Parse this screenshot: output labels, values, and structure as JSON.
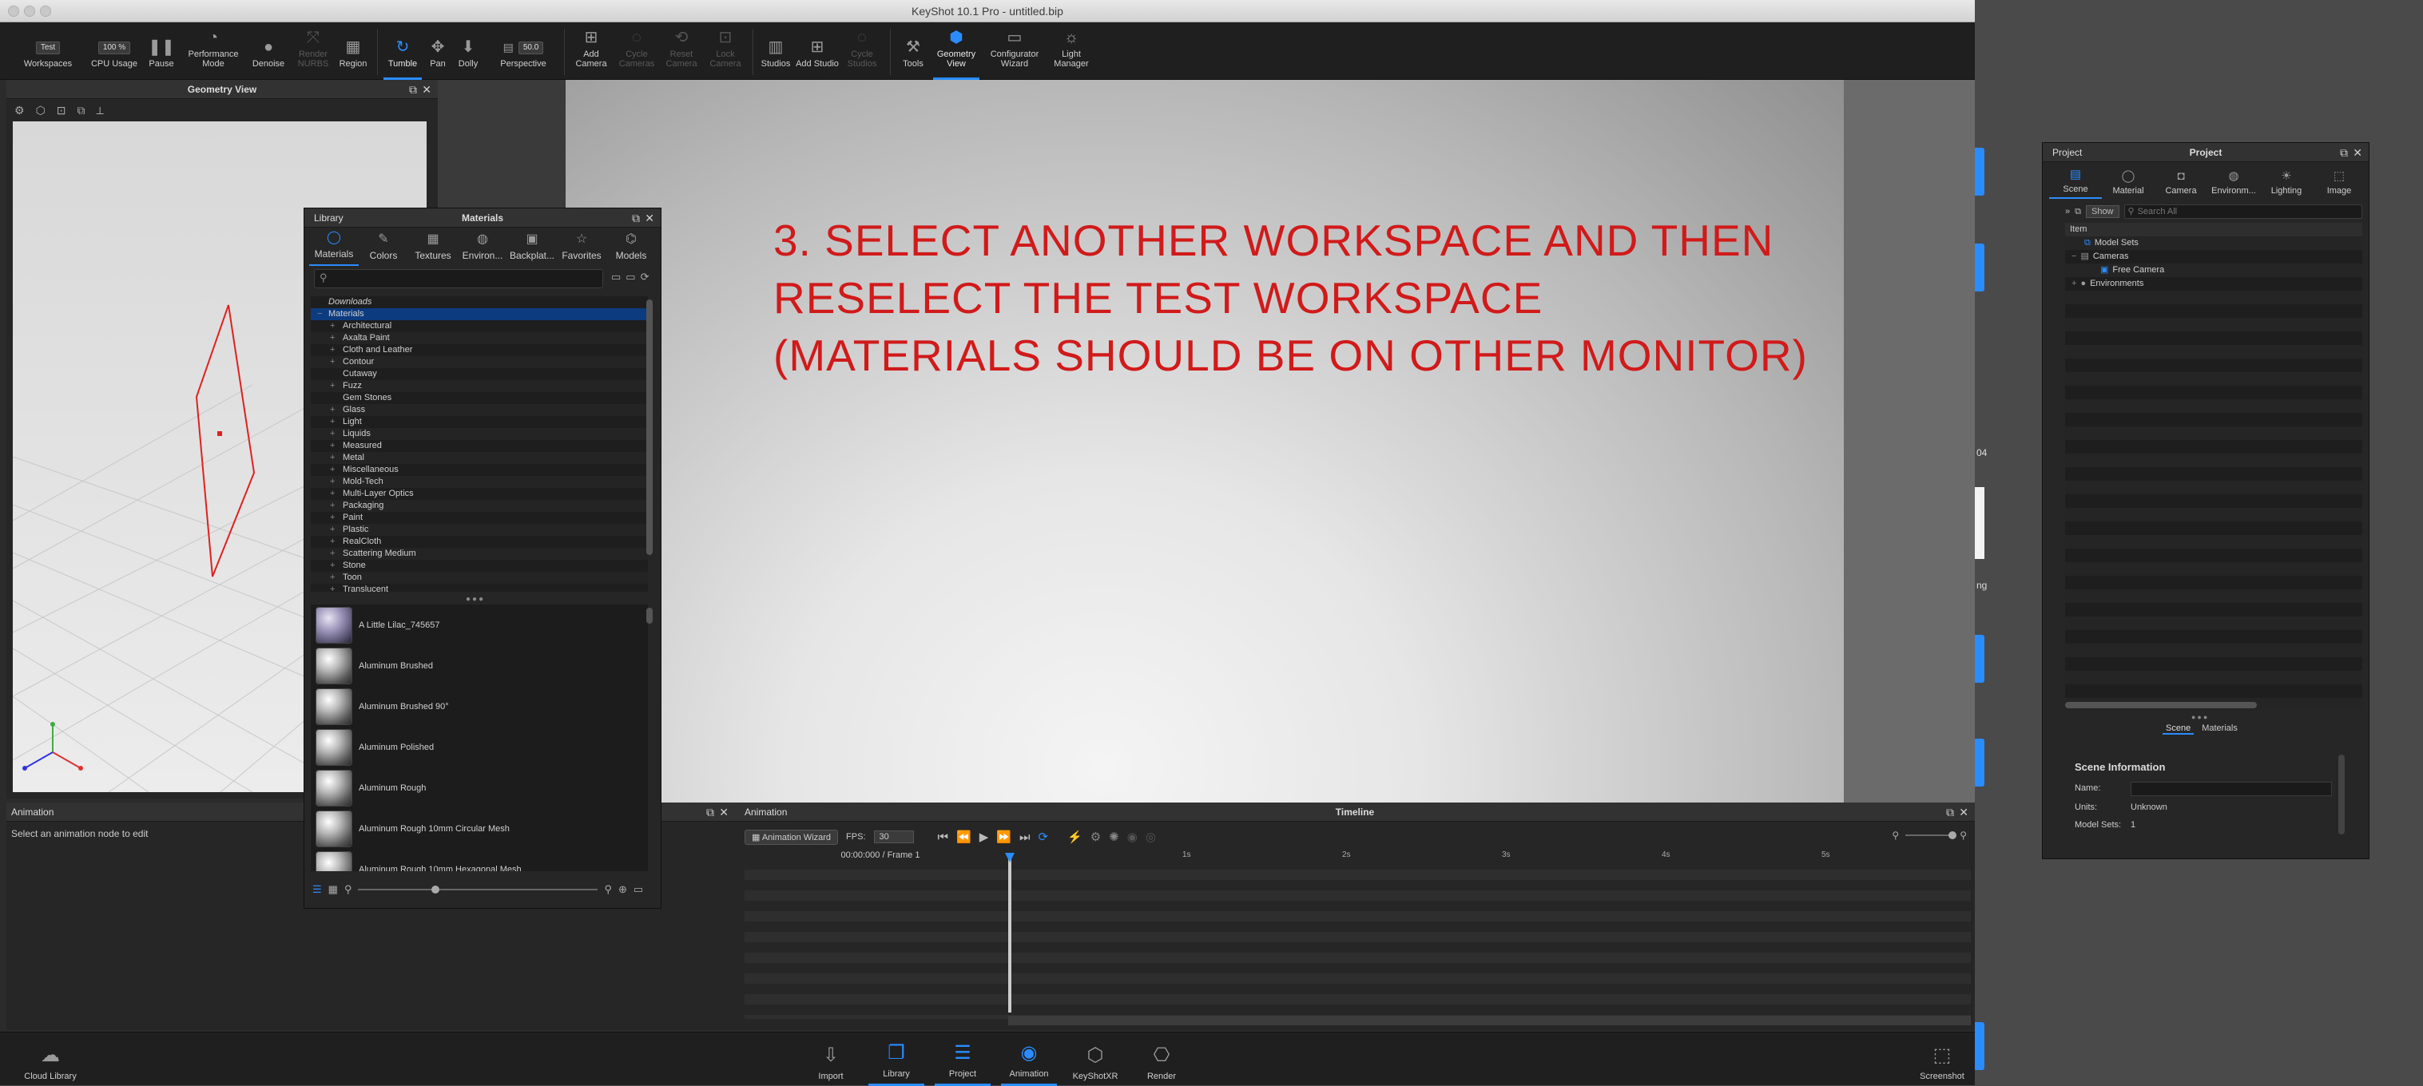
{
  "window": {
    "title": "KeyShot 10.1 Pro - untitled.bip"
  },
  "ribbon": {
    "workspace_select": "Test",
    "cpu_value": "100 %",
    "fov_value": "50.0",
    "items": [
      {
        "label": "Workspaces",
        "icon": "workspaces-icon"
      },
      {
        "label": "CPU Usage",
        "icon": "cpu-icon"
      },
      {
        "label": "Pause",
        "icon": "pause-icon"
      },
      {
        "label": "Performance Mode",
        "icon": "performance-icon"
      },
      {
        "label": "Denoise",
        "icon": "denoise-icon"
      },
      {
        "label": "Render NURBS",
        "icon": "nurbs-icon"
      },
      {
        "label": "Region",
        "icon": "region-icon"
      },
      {
        "label": "Tumble",
        "icon": "tumble-icon"
      },
      {
        "label": "Pan",
        "icon": "pan-icon"
      },
      {
        "label": "Dolly",
        "icon": "dolly-icon"
      },
      {
        "label": "Perspective",
        "icon": "perspective-icon"
      },
      {
        "label": "Add Camera",
        "icon": "add-camera-icon"
      },
      {
        "label": "Cycle Cameras",
        "icon": "cycle-cameras-icon"
      },
      {
        "label": "Reset Camera",
        "icon": "reset-camera-icon"
      },
      {
        "label": "Lock Camera",
        "icon": "lock-camera-icon"
      },
      {
        "label": "Studios",
        "icon": "studios-icon"
      },
      {
        "label": "Add Studio",
        "icon": "add-studio-icon"
      },
      {
        "label": "Cycle Studios",
        "icon": "cycle-studios-icon"
      },
      {
        "label": "Tools",
        "icon": "tools-icon"
      },
      {
        "label": "Geometry View",
        "icon": "geometry-view-icon"
      },
      {
        "label": "Configurator Wizard",
        "icon": "configurator-icon"
      },
      {
        "label": "Light Manager",
        "icon": "light-manager-icon"
      }
    ]
  },
  "geometry_view": {
    "title": "Geometry View"
  },
  "overlay_text": "3. SELECT ANOTHER WORKSPACE AND THEN RESELECT THE TEST WORKSPACE (MATERIALS SHOULD BE ON OTHER MONITOR)",
  "library": {
    "left_label": "Library",
    "title": "Materials",
    "tabs": [
      "Materials",
      "Colors",
      "Textures",
      "Environ...",
      "Backplat...",
      "Favorites",
      "Models"
    ],
    "tree": [
      "Downloads",
      "Materials",
      "Architectural",
      "Axalta Paint",
      "Cloth and Leather",
      "Contour",
      "Cutaway",
      "Fuzz",
      "Gem Stones",
      "Glass",
      "Light",
      "Liquids",
      "Measured",
      "Metal",
      "Miscellaneous",
      "Mold-Tech",
      "Multi-Layer Optics",
      "Packaging",
      "Paint",
      "Plastic",
      "RealCloth",
      "Scattering Medium",
      "Stone",
      "Toon",
      "Translucent"
    ],
    "materials": [
      "A Little Lilac_745657",
      "Aluminum Brushed",
      "Aluminum Brushed 90°",
      "Aluminum Polished",
      "Aluminum Rough",
      "Aluminum Rough 10mm Circular Mesh",
      "Aluminum Rough 10mm Hexagonal Mesh"
    ]
  },
  "animation_panel": {
    "title": "Animation",
    "message": "Select an animation node to edit"
  },
  "timeline": {
    "left_label": "Animation",
    "title": "Timeline",
    "wizard_label": "Animation Wizard",
    "fps_label": "FPS:",
    "fps_value": "30",
    "time": "00:00:000 / Frame 1",
    "ticks": [
      "1s",
      "2s",
      "3s",
      "4s",
      "5s"
    ]
  },
  "bottom": {
    "cloud": "Cloud Library",
    "items": [
      {
        "label": "Import",
        "icon": "import-icon"
      },
      {
        "label": "Library",
        "icon": "library-icon"
      },
      {
        "label": "Project",
        "icon": "project-icon"
      },
      {
        "label": "Animation",
        "icon": "animation-icon"
      },
      {
        "label": "KeyShotXR",
        "icon": "keyshotxr-icon"
      },
      {
        "label": "Render",
        "icon": "render-icon"
      }
    ],
    "screenshot": "Screenshot"
  },
  "project": {
    "left_label": "Project",
    "title": "Project",
    "tabs": [
      "Scene",
      "Material",
      "Camera",
      "Environm...",
      "Lighting",
      "Image"
    ],
    "show_label": "Show",
    "search_placeholder": "Search All",
    "column": "Item",
    "tree": [
      "Model Sets",
      "Cameras",
      "Free Camera",
      "Environments"
    ],
    "bottom_tabs": [
      "Scene",
      "Materials"
    ],
    "info_title": "Scene Information",
    "name_label": "Name:",
    "units_label": "Units:",
    "units_value": "Unknown",
    "modelsets_label": "Model Sets:",
    "modelsets_value": "1"
  },
  "right_edge": {
    "text1": "04",
    "text2": "ng"
  }
}
